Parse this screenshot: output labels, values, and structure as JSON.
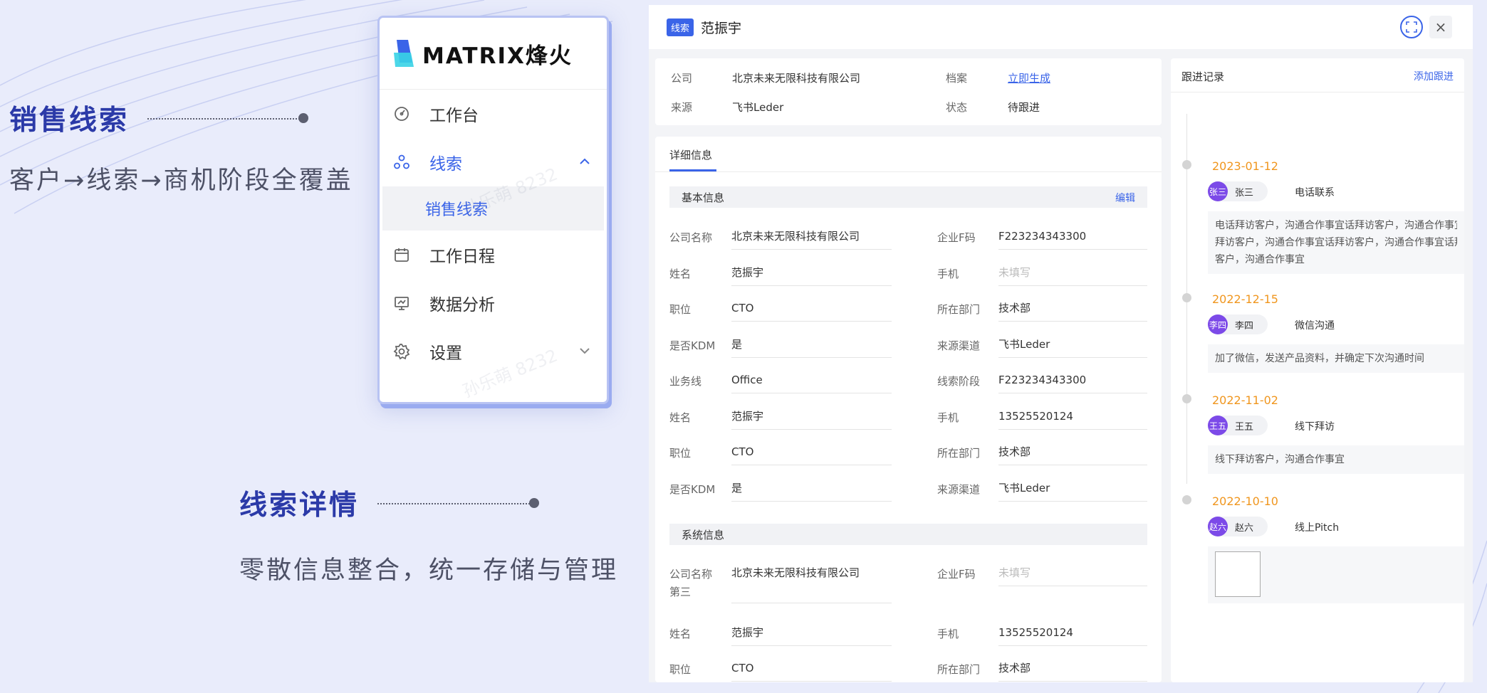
{
  "promo": {
    "lead_title": "销售线索",
    "lead_sub": "客户→线索→商机阶段全覆盖",
    "detail_title": "线索详情",
    "detail_sub": "零散信息整合，统一存储与管理"
  },
  "sidebar": {
    "brand": "MATRIX烽火",
    "watermark": "孙乐萌 8232",
    "items": [
      {
        "label": "工作台",
        "icon": "dashboard-icon"
      },
      {
        "label": "线索",
        "icon": "leads-icon"
      },
      {
        "label": "销售线索"
      },
      {
        "label": "工作日程",
        "icon": "calendar-icon"
      },
      {
        "label": "数据分析",
        "icon": "analytics-icon"
      },
      {
        "label": "设置",
        "icon": "gear-icon"
      }
    ]
  },
  "detail": {
    "tag": "线索",
    "name": "范振宇",
    "close_glyph": "×",
    "summary": {
      "company_label": "公司",
      "company_value": "北京未来无限科技有限公司",
      "archive_label": "档案",
      "archive_link": "立即生成",
      "source_label": "来源",
      "source_value": "飞书Leder",
      "status_label": "状态",
      "status_value": "待跟进"
    },
    "tab": "详细信息",
    "basic": {
      "title": "基本信息",
      "edit": "编辑",
      "rows": [
        {
          "l1": "公司名称",
          "v1": "北京未来无限科技有限公司",
          "l2": "企业F码",
          "v2": "F223234343300"
        },
        {
          "l1": "姓名",
          "v1": "范振宇",
          "l2": "手机",
          "v2": "未填写"
        },
        {
          "l1": "职位",
          "v1": "CTO",
          "l2": "所在部门",
          "v2": "技术部"
        },
        {
          "l1": "是否KDM",
          "v1": "是",
          "l2": "来源渠道",
          "v2": "飞书Leder"
        },
        {
          "l1": "业务线",
          "v1": "Office",
          "l2": "线索阶段",
          "v2": "F223234343300"
        },
        {
          "l1": "姓名",
          "v1": "范振宇",
          "l2": "手机",
          "v2": "13525520124"
        },
        {
          "l1": "职位",
          "v1": "CTO",
          "l2": "所在部门",
          "v2": "技术部"
        },
        {
          "l1": "是否KDM",
          "v1": "是",
          "l2": "来源渠道",
          "v2": "飞书Leder"
        }
      ]
    },
    "system": {
      "title": "系统信息",
      "rows": [
        {
          "l1": "公司名称",
          "l1b": "第三",
          "v1": "北京未来无限科技有限公司",
          "l2": "企业F码",
          "v2": "未填写"
        },
        {
          "l1": "姓名",
          "v1": "范振宇",
          "l2": "手机",
          "v2": "13525520124"
        },
        {
          "l1": "职位",
          "v1": "CTO",
          "l2": "所在部门",
          "v2": "技术部"
        }
      ]
    }
  },
  "follow": {
    "title": "跟进记录",
    "add": "添加跟进",
    "records": [
      {
        "date": "2023-01-12",
        "avatar": "张三",
        "user": "张三",
        "method": "电话联系",
        "lines": [
          "电话拜访客户，沟通合作事宜话拜访客户，沟通合作事宜",
          "拜访客户，沟通合作事宜话拜访客户，沟通合作事宜话拜访",
          "客户，沟通合作事宜"
        ]
      },
      {
        "date": "2022-12-15",
        "avatar": "李四",
        "user": "李四",
        "method": "微信沟通",
        "lines": [
          "加了微信，发送产品资料，并确定下次沟通时间"
        ]
      },
      {
        "date": "2022-11-02",
        "avatar": "王五",
        "user": "王五",
        "method": "线下拜访",
        "lines": [
          "线下拜访客户，沟通合作事宜"
        ]
      },
      {
        "date": "2022-10-10",
        "avatar": "赵六",
        "user": "赵六",
        "method": "线上Pitch",
        "lines": []
      }
    ]
  },
  "colors": {
    "accent": "#3a64e8",
    "date": "#f0961e",
    "avatar": "#7c4ae8",
    "promo_title": "#2b3aa8"
  }
}
